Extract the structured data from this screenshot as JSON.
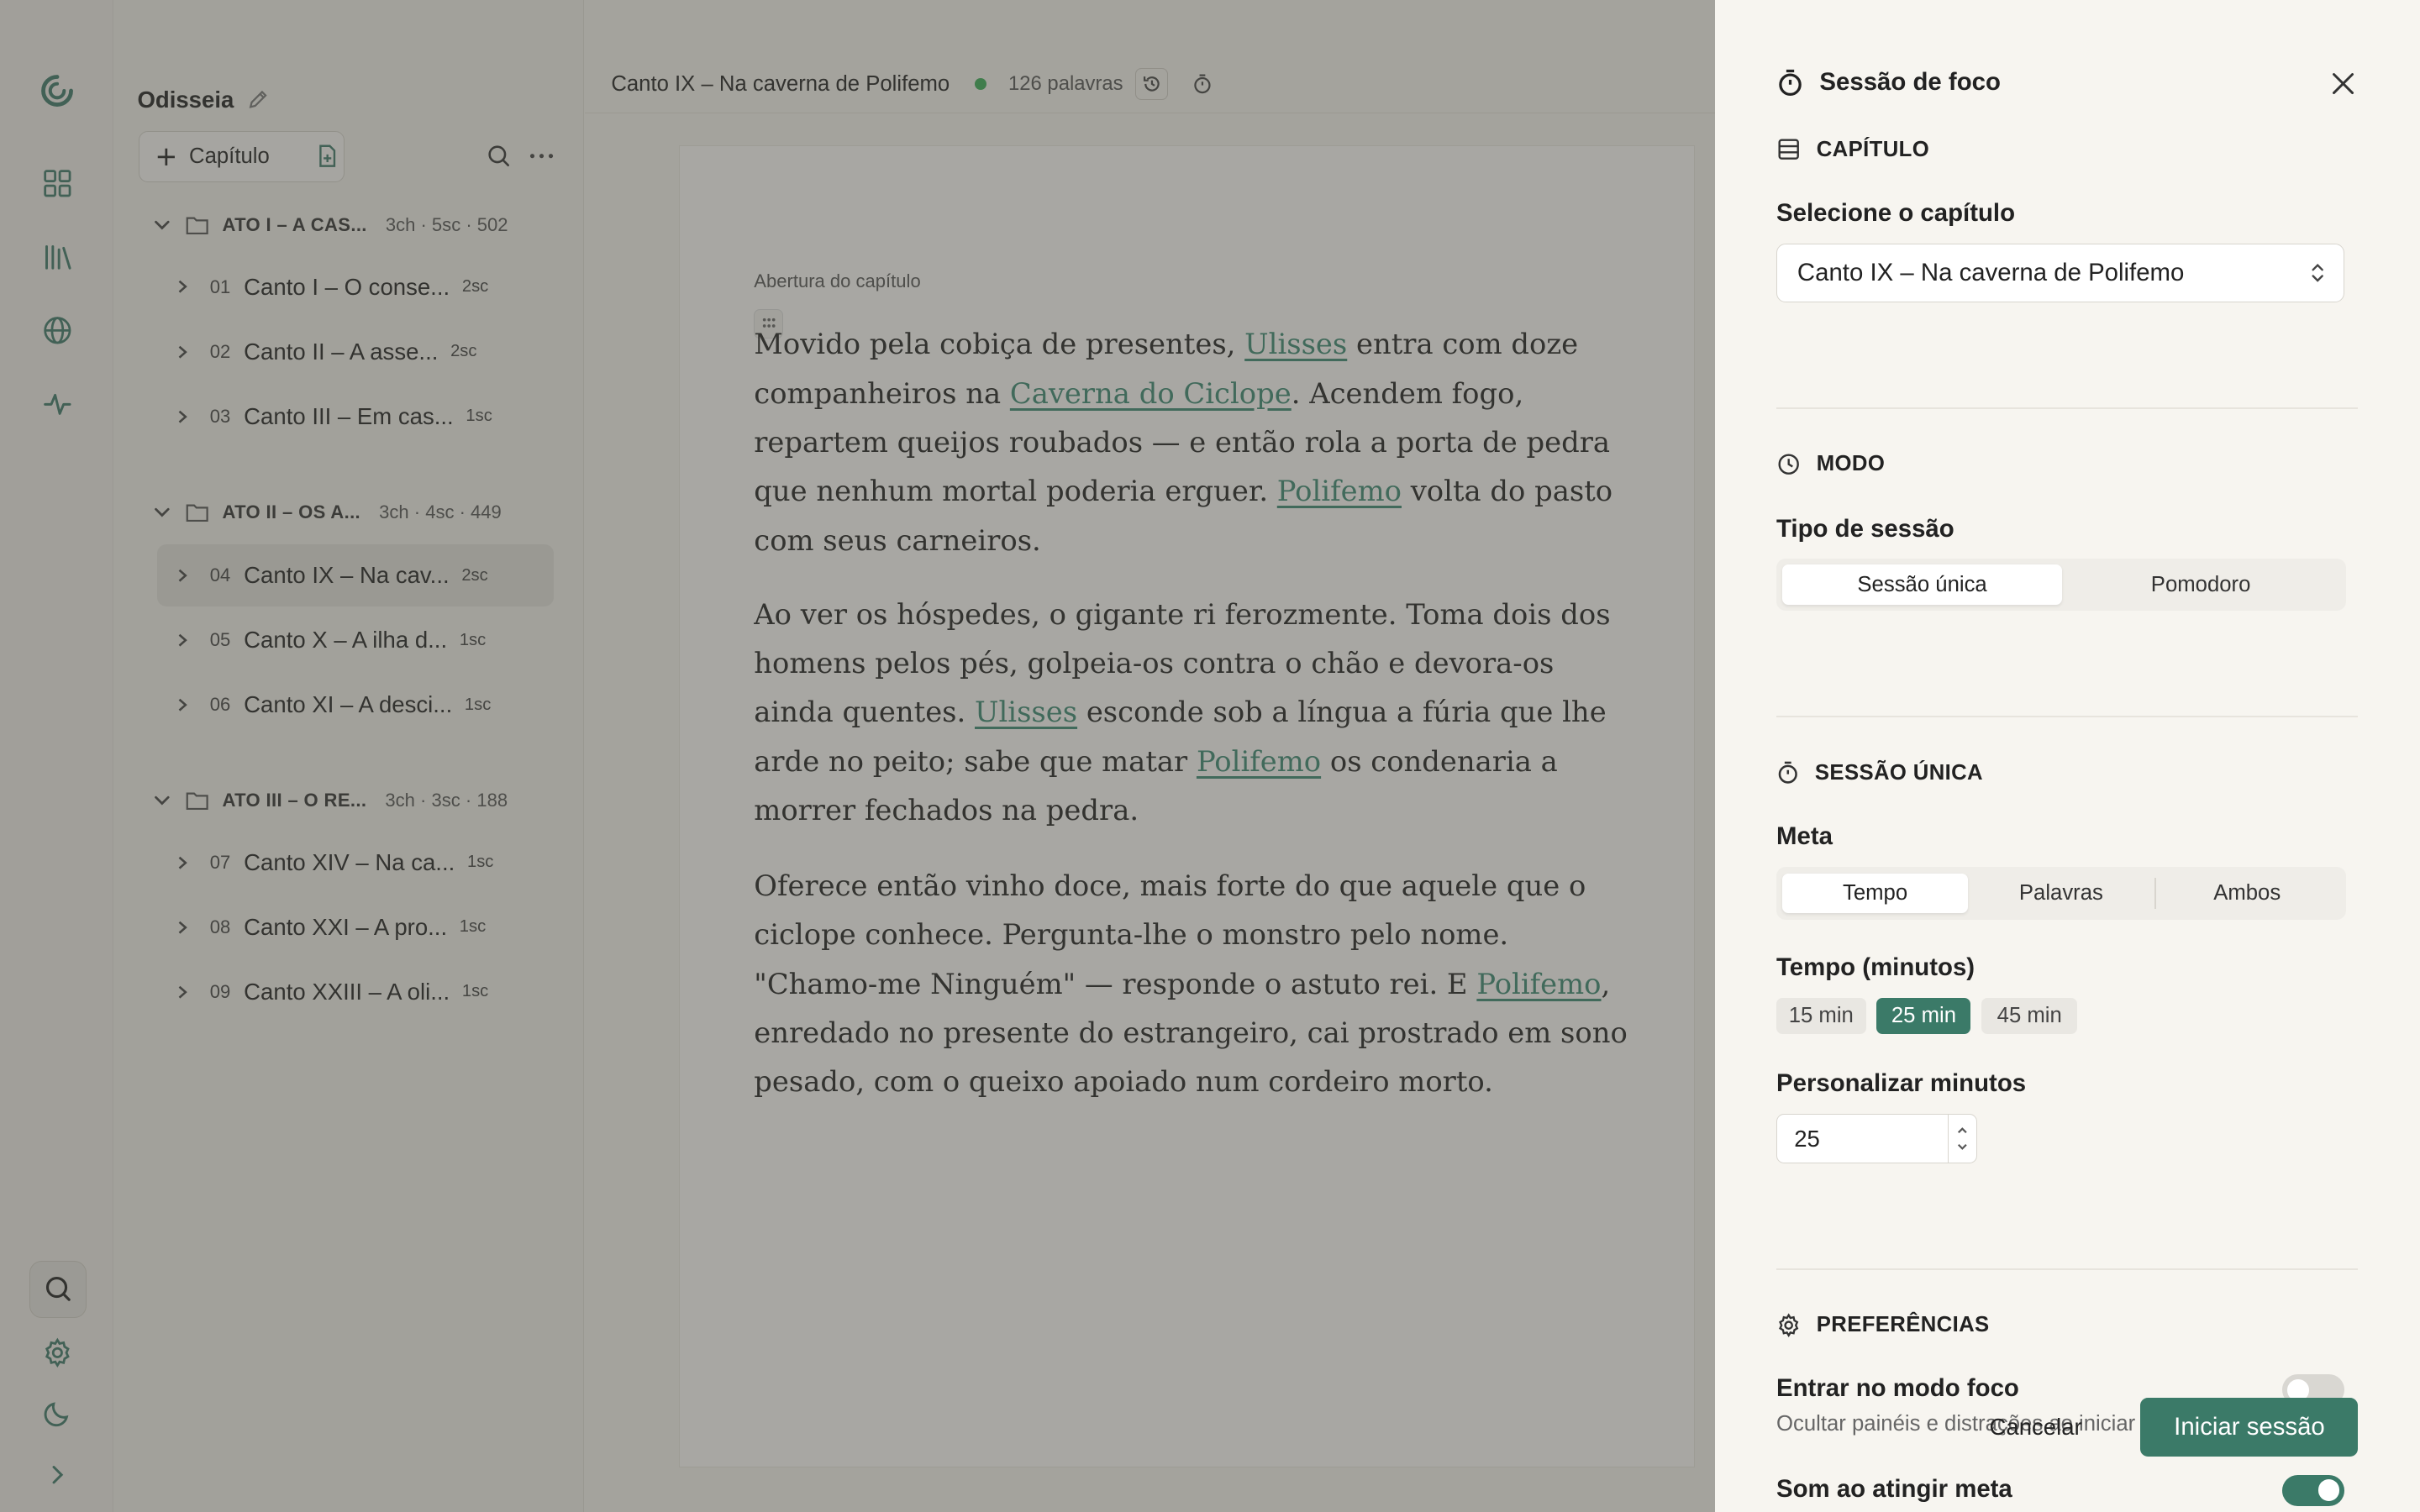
{
  "sidebar": {
    "nav": [
      "logo-icon",
      "grid-icon",
      "library-icon",
      "globe-icon",
      "activity-icon"
    ],
    "bottom": [
      "search-icon",
      "gear-icon",
      "moon-icon",
      "chevron-right-icon"
    ]
  },
  "project": {
    "title": "Odisseia",
    "add_chapter_label": "Capítulo",
    "acts": [
      {
        "label": "ATO I – A CAS...",
        "meta": "3ch · 5sc · 502",
        "chapters": [
          {
            "num": "01",
            "title": "Canto I – O conse...",
            "meta": "2sc"
          },
          {
            "num": "02",
            "title": "Canto II – A asse...",
            "meta": "2sc"
          },
          {
            "num": "03",
            "title": "Canto III – Em cas...",
            "meta": "1sc"
          }
        ]
      },
      {
        "label": "ATO II – OS A...",
        "meta": "3ch · 4sc · 449",
        "chapters": [
          {
            "num": "04",
            "title": "Canto IX – Na cav...",
            "meta": "2sc"
          },
          {
            "num": "05",
            "title": "Canto X – A ilha d...",
            "meta": "1sc"
          },
          {
            "num": "06",
            "title": "Canto XI – A desci...",
            "meta": "1sc"
          }
        ]
      },
      {
        "label": "ATO III – O RE...",
        "meta": "3ch · 3sc · 188",
        "chapters": [
          {
            "num": "07",
            "title": "Canto XIV – Na ca...",
            "meta": "1sc"
          },
          {
            "num": "08",
            "title": "Canto XXI – A pro...",
            "meta": "1sc"
          },
          {
            "num": "09",
            "title": "Canto XXIII – A oli...",
            "meta": "1sc"
          }
        ]
      }
    ]
  },
  "editor": {
    "chapter_title": "Canto IX – Na caverna de Polifemo",
    "word_count": "126 palavras",
    "scene_label": "Abertura do capítulo",
    "p1": {
      "a": "Movido pela cobiça de presentes, ",
      "e1": "Ulisses",
      "b": " entra com doze companheiros na ",
      "e2": "Caverna do Ciclope",
      "c": ". Acendem fogo, repartem queijos roubados — e então rola a porta de pedra que nenhum mortal poderia erguer. ",
      "e3": "Polifemo",
      "d": " volta do pasto com seus carneiros."
    },
    "p2": {
      "a": "Ao ver os hóspedes, o gigante ri ferozmente. Toma dois dos homens pelos pés, golpeia-os contra o chão e devora-os ainda quentes. ",
      "e1": "Ulisses",
      "b": " esconde sob a língua a fúria que lhe arde no peito; sabe que matar ",
      "e2": "Polifemo",
      "c": " os condenaria a morrer fechados na pedra."
    },
    "p3": {
      "a": "Oferece então vinho doce, mais forte do que aquele que o ciclope conhece. Pergunta-lhe o monstro pelo nome. \"Chamo-me Ninguém\" — responde o astuto rei. E ",
      "e1": "Polifemo",
      "b": ", enredado no presente do estrangeiro, cai prostrado em sono pesado, com o queixo apoiado num cordeiro morto."
    }
  },
  "panel": {
    "title": "Sessão de foco",
    "chapter_section": "CAPÍTULO",
    "select_label": "Selecione o capítulo",
    "select_value": "Canto IX – Na caverna de Polifemo",
    "mode_section": "MODO",
    "session_type_label": "Tipo de sessão",
    "session_types": [
      "Sessão única",
      "Pomodoro"
    ],
    "single_section": "SESSÃO ÚNICA",
    "goal_label": "Meta",
    "goal_options": [
      "Tempo",
      "Palavras",
      "Ambos"
    ],
    "time_label": "Tempo (minutos)",
    "time_chips": [
      "15 min",
      "25 min",
      "45 min"
    ],
    "custom_label": "Personalizar minutos",
    "custom_value": "25",
    "prefs_section": "PREFERÊNCIAS",
    "focus_mode_label": "Entrar no modo foco",
    "focus_mode_desc": "Ocultar painéis e distrações ao iniciar",
    "focus_mode_on": false,
    "sound_label": "Som ao atingir meta",
    "sound_on": true,
    "cancel_label": "Cancelar",
    "start_label": "Iniciar sessão",
    "accent": "#3b7a68"
  }
}
